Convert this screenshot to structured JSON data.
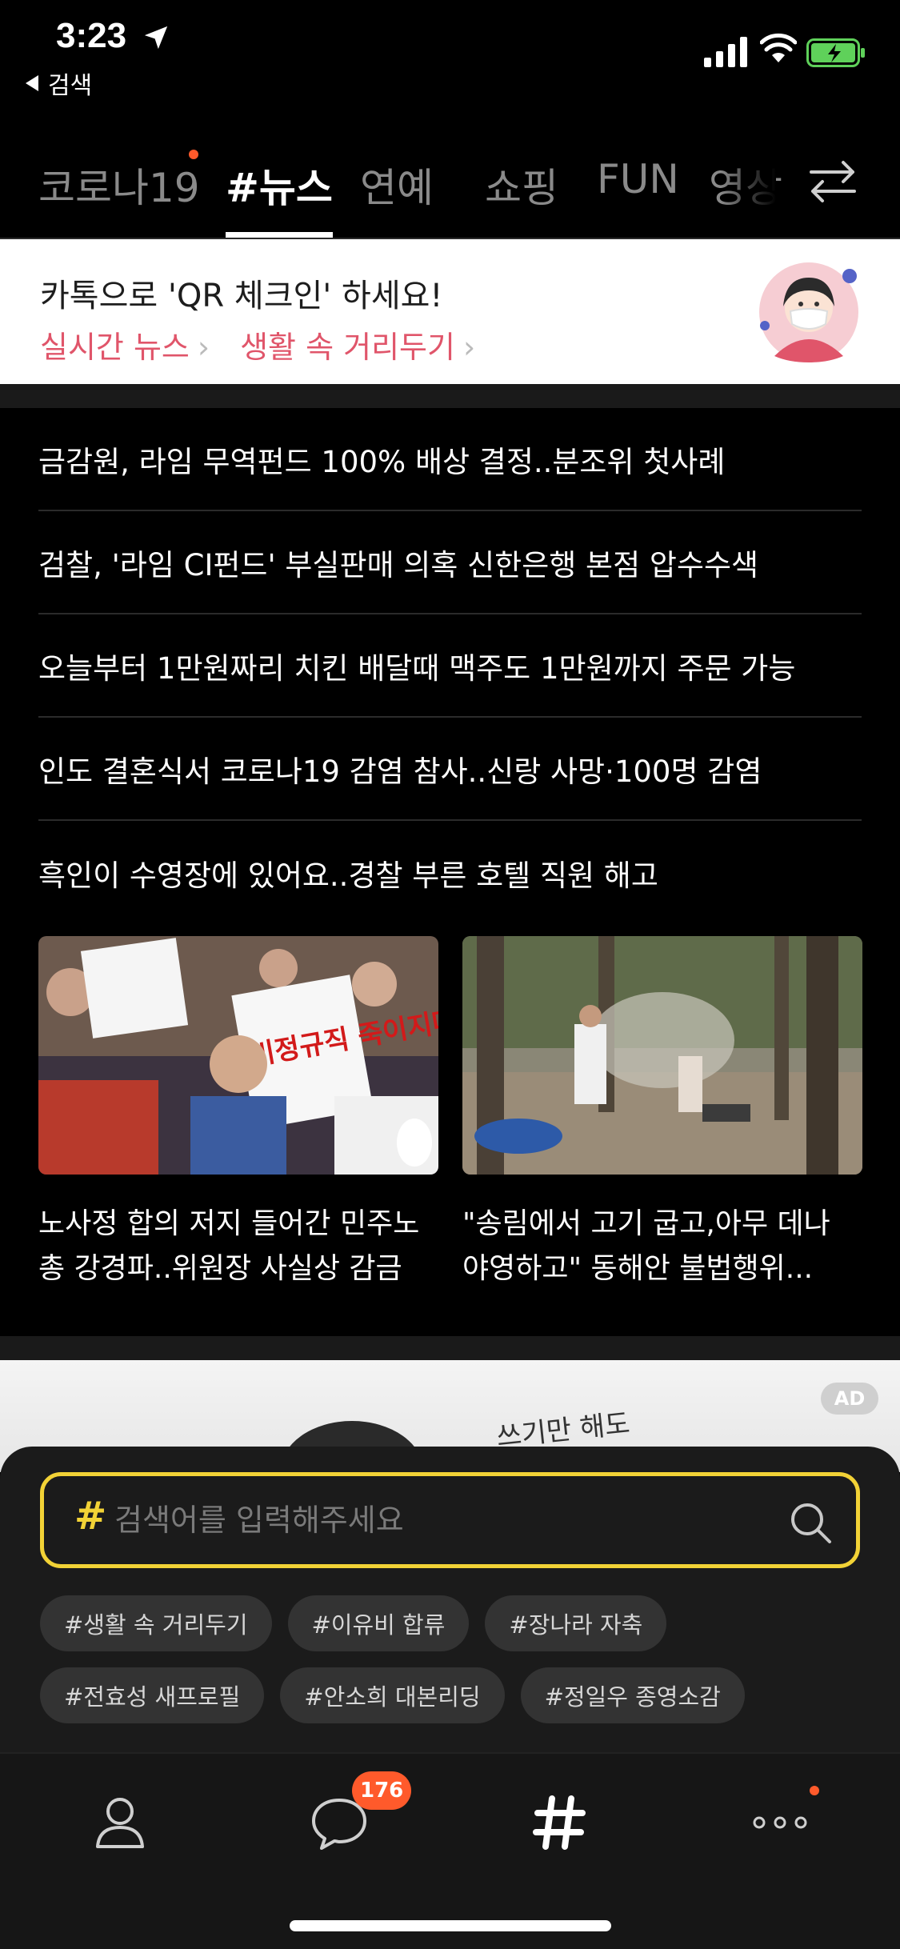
{
  "status_bar": {
    "time": "3:23",
    "back_label": "검색"
  },
  "tabs": {
    "items": [
      "코로나19",
      "#뉴스",
      "연예",
      "쇼핑",
      "FUN",
      "영상"
    ],
    "active": "#뉴스"
  },
  "banner": {
    "title": "카톡으로 'QR 체크인' 하세요!",
    "link1": "실시간 뉴스",
    "link2": "생활 속 거리두기",
    "chevron": "›"
  },
  "news": {
    "items": [
      "금감원, 라임 무역펀드 100% 배상 결정..분조위 첫사례",
      "검찰, '라임 CI펀드' 부실판매 의혹 신한은행 본점 압수수색",
      "오늘부터 1만원짜리 치킨 배달때 맥주도 1만원까지 주문 가능",
      "인도 결혼식서 코로나19 감염 참사..신랑 사망·100명 감염",
      "흑인이 수영장에 있어요..경찰 부른 호텔 직원 해고"
    ]
  },
  "cards": {
    "left_title": "노사정 합의 저지 들어간 민주노총 강경파..위원장 사실상 감금",
    "left_img_text": "비정규직 죽이지마라",
    "right_title": "\"송림에서 고기 굽고,아무 데나 야영하고\" 동해안 불법행위..."
  },
  "ad": {
    "badge": "AD",
    "text": "쓰기만 해도"
  },
  "search": {
    "hash": "#",
    "placeholder": "검색어를 입력해주세요",
    "chips_row1": [
      "#생활 속 거리두기",
      "#이유비 합류",
      "#장나라 자축"
    ],
    "chips_row2": [
      "#전효성 새프로필",
      "#안소희 대본리딩",
      "#정일우 종영소감"
    ]
  },
  "bottom_nav": {
    "chat_badge": "176"
  },
  "colors": {
    "accent_yellow": "#f2d236",
    "badge_orange": "#ff5a2b",
    "link_pink": "#e0556a"
  }
}
